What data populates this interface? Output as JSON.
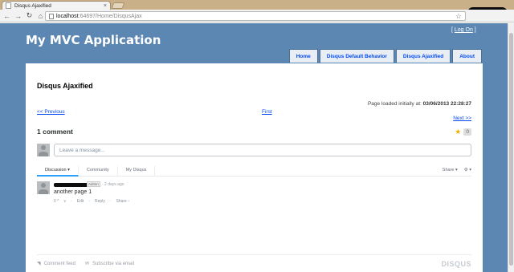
{
  "browser": {
    "tab_title": "Disqus Ajaxified",
    "url_host": "localhost",
    "url_path": ":64697/Home/DisqusAjax"
  },
  "header": {
    "site_title": "My MVC Application",
    "login_prefix": "[ ",
    "login_label": "Log On",
    "login_suffix": " ]"
  },
  "menu": {
    "items": [
      "Home",
      "Disqus Default Behavior",
      "Disqus Ajaxified",
      "About"
    ]
  },
  "main": {
    "heading": "Disqus Ajaxified",
    "loaded_label": "Page loaded initially at:",
    "loaded_value": "03/06/2013 22:28:27",
    "prev_label": "<< Previous",
    "first_label": "First",
    "next_label": "Next >>"
  },
  "disqus": {
    "comment_count": "1 comment",
    "fav_count": "0",
    "message_placeholder": "Leave a message...",
    "tabs": [
      "Discussion ▾",
      "Community",
      "My Disqus"
    ],
    "share_label": "Share ▾",
    "settings_label": "⚙ ▾",
    "comment": {
      "badge": "Admin",
      "time": "· 2 days ago",
      "text": "another page 1",
      "actions": [
        "0 ^",
        "v",
        "·",
        "Edit",
        "·",
        "Reply",
        "·",
        "Share ›"
      ]
    },
    "footer": {
      "feed_label": "Comment feed",
      "email_label": "Subscribe via email",
      "logo": "DISQUS"
    }
  }
}
